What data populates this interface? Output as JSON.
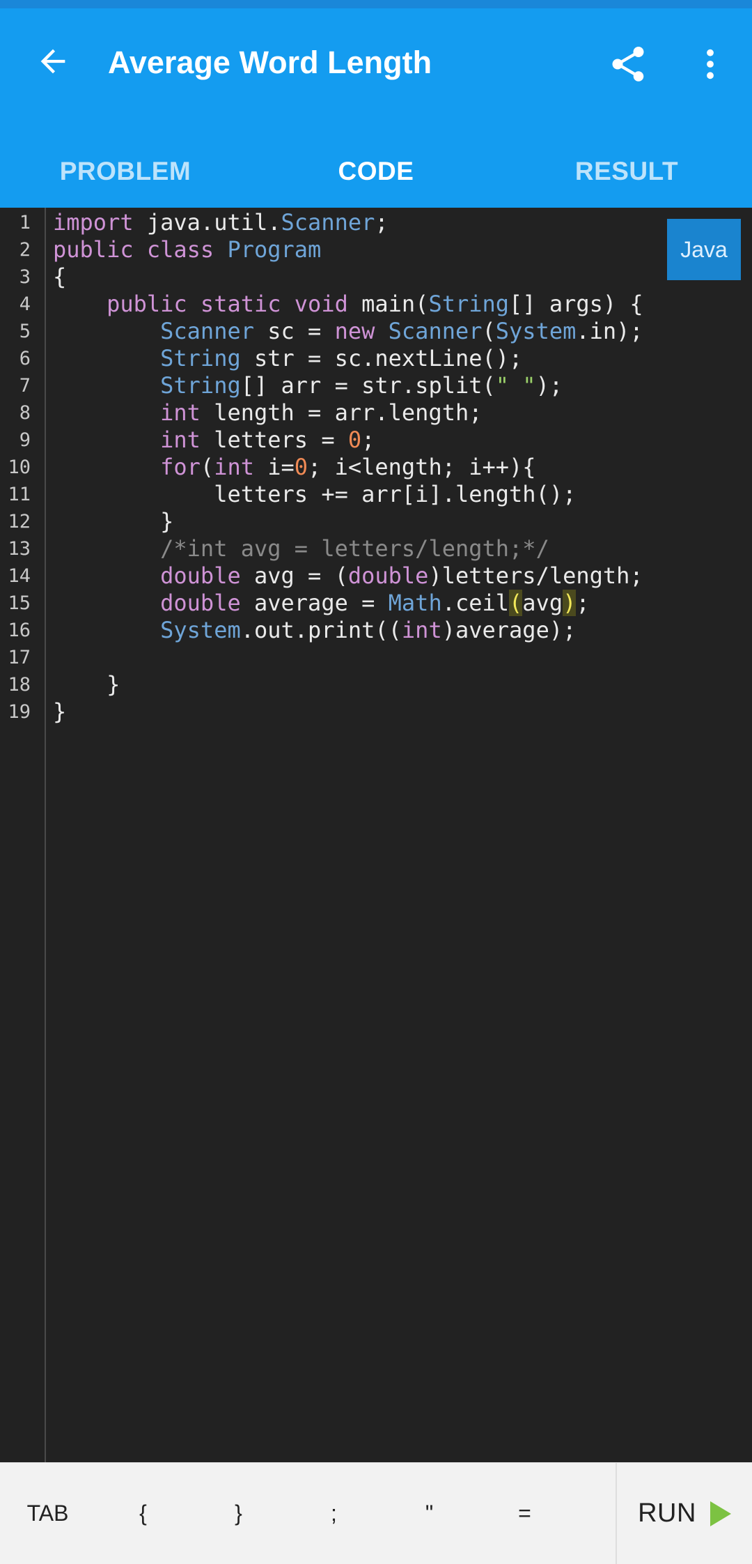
{
  "appbar": {
    "title": "Average Word Length",
    "back_icon": "arrow-left-icon",
    "share_icon": "share-icon",
    "more_icon": "more-vertical-icon"
  },
  "tabs": [
    {
      "label": "PROBLEM",
      "active": false
    },
    {
      "label": "CODE",
      "active": true
    },
    {
      "label": "RESULT",
      "active": false
    }
  ],
  "editor": {
    "language": "Java",
    "line_numbers": [
      "1",
      "2",
      "3",
      "4",
      "5",
      "6",
      "7",
      "8",
      "9",
      "10",
      "11",
      "12",
      "13",
      "14",
      "15",
      "16",
      "17",
      "18",
      "19"
    ],
    "lines": [
      "import java.util.Scanner;",
      "public class Program",
      "{",
      "    public static void main(String[] args) {",
      "        Scanner sc = new Scanner(System.in);",
      "        String str = sc.nextLine();",
      "        String[] arr = str.split(\" \");",
      "        int length = arr.length;",
      "        int letters = 0;",
      "        for(int i=0; i<length; i++){",
      "            letters += arr[i].length();",
      "        }",
      "        /*int avg = letters/length;*/",
      "        double avg = (double)letters/length;",
      "        double average = Math.ceil(avg);",
      "        System.out.print((int)average);",
      "",
      "    }",
      "}"
    ]
  },
  "keybar": {
    "keys": [
      "TAB",
      "{",
      "}",
      ";",
      "\"",
      "="
    ],
    "run_label": "RUN",
    "run_icon": "play-icon",
    "colors": {
      "run_icon": "#7cc242"
    }
  },
  "colors": {
    "appbar": "#149cf0",
    "editor_bg": "#222222",
    "keyword": "#cf93d6",
    "type": "#6fa5d8",
    "number": "#f08a55",
    "string": "#9bd06a",
    "comment": "#8a8a8a"
  }
}
